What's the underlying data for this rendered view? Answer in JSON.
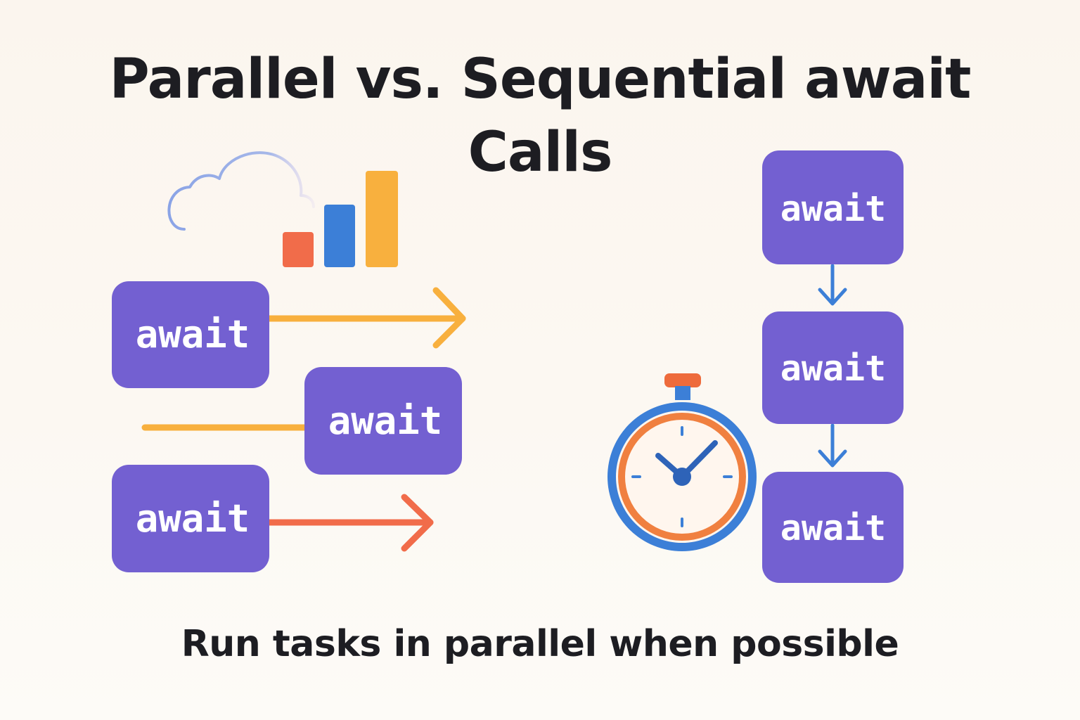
{
  "title": {
    "line1": "Parallel vs. Sequential await",
    "line2": "Calls"
  },
  "subtitle": "Run tasks in parallel when possible",
  "parallel": {
    "blocks": [
      "await",
      "await",
      "await"
    ]
  },
  "sequential": {
    "blocks": [
      "await",
      "await",
      "await"
    ]
  },
  "icons": {
    "cloud": "cloud-icon",
    "bars": "bar-chart-icon",
    "stopwatch": "stopwatch-icon"
  },
  "colors": {
    "title_text": "#1d1d22",
    "block_fill": "#7360d1",
    "block_text": "#ffffff",
    "arrow_orange": "#f8b03e",
    "arrow_red": "#f16c4a",
    "arrow_blue": "#3c7fd7",
    "bar_red": "#f16c4a",
    "bar_blue": "#3c7fd7",
    "bar_yellow": "#f8b03e",
    "cloud_stroke": "#8aa3e6",
    "clock_ring_outer": "#3c7fd7",
    "clock_ring_inner": "#f08040",
    "clock_face": "#fff6ee",
    "clock_hand": "#2e63b8",
    "clock_button": "#ee6b3c"
  }
}
